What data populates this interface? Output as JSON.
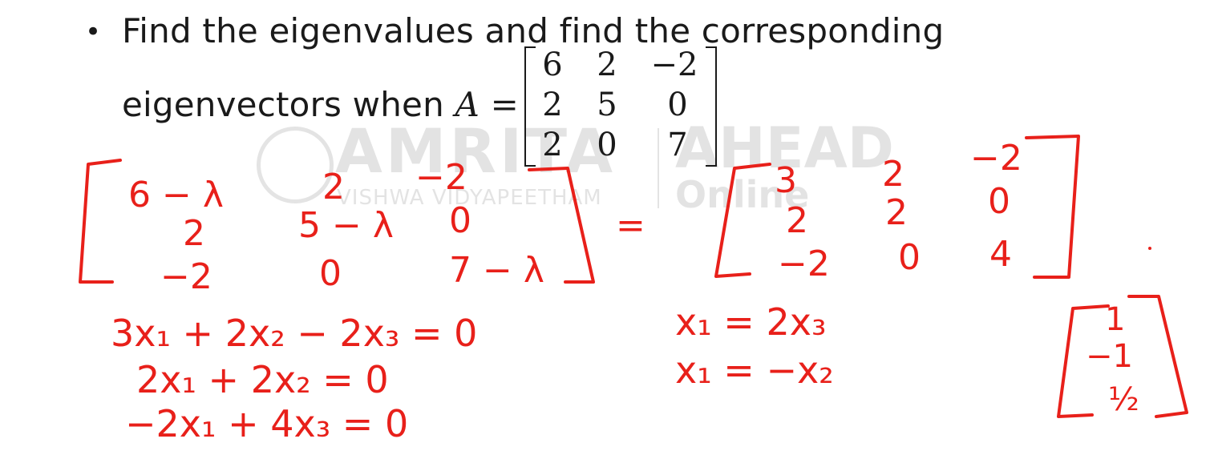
{
  "slide": {
    "bullet": "•",
    "line1": "Find the eigenvalues and find the corresponding",
    "line2_prefix": "eigenvectors when ",
    "matrix_symbol": "A",
    "equals": "=",
    "matrix": [
      [
        "6",
        "2",
        "−2"
      ],
      [
        "2",
        "5",
        "0"
      ],
      [
        "2",
        "0",
        "7"
      ]
    ]
  },
  "watermark": {
    "name": "AMRITA",
    "subtitle": "VISHWA VIDYAPEETHAM",
    "brand": "AHEAD",
    "brand_sub": "Online"
  },
  "handwriting": {
    "color": "#e8201a",
    "left_matrix": [
      [
        "6 − λ",
        "2",
        "−2"
      ],
      [
        "2",
        "5 − λ",
        "0"
      ],
      [
        "−2",
        "0",
        "7 − λ"
      ]
    ],
    "equals": "=",
    "right_matrix": [
      [
        "3",
        "2",
        "−2"
      ],
      [
        "2",
        "2",
        "0"
      ],
      [
        "−2",
        "0",
        "4"
      ]
    ],
    "equations": [
      "3x₁ + 2x₂ − 2x₃ = 0",
      "2x₁ + 2x₂ = 0",
      "−2x₁ + 4x₃ = 0"
    ],
    "relations": [
      "x₁ = 2x₃",
      "x₁ = −x₂"
    ],
    "eigenvector": [
      "1",
      "−1",
      "½"
    ]
  }
}
